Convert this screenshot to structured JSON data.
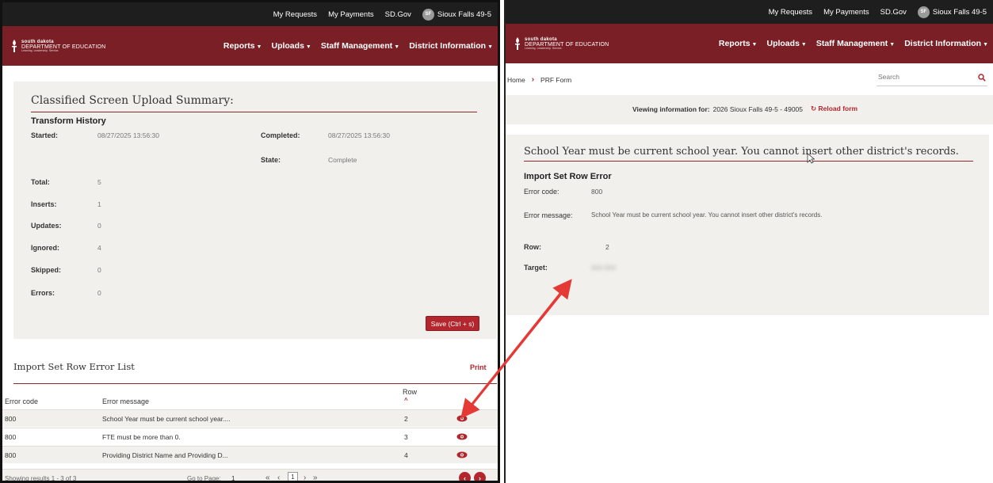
{
  "topbar": {
    "links": [
      "My Requests",
      "My Payments",
      "SD.Gov"
    ],
    "avatar_initials": "SF",
    "user": "Sioux Falls 49-5"
  },
  "brand": {
    "line1": "south dakota",
    "line2": "DEPARTMENT OF EDUCATION",
    "tagline": "Learning. Leadership. Service."
  },
  "nav": {
    "items": [
      "Reports",
      "Uploads",
      "Staff Management",
      "District Information"
    ]
  },
  "summary": {
    "title": "Classified Screen Upload Summary:",
    "section": "Transform History",
    "started_label": "Started:",
    "started_value": "08/27/2025 13:56:30",
    "completed_label": "Completed:",
    "completed_value": "08/27/2025 13:56:30",
    "state_label": "State:",
    "state_value": "Complete",
    "counts": [
      {
        "label": "Total:",
        "value": "5"
      },
      {
        "label": "Inserts:",
        "value": "1"
      },
      {
        "label": "Updates:",
        "value": "0"
      },
      {
        "label": "Ignored:",
        "value": "4"
      },
      {
        "label": "Skipped:",
        "value": "0"
      },
      {
        "label": "Errors:",
        "value": "0"
      }
    ],
    "save_label": "Save (Ctrl + s)"
  },
  "error_list": {
    "title": "Import Set Row Error List",
    "print_label": "Print",
    "headers": {
      "code": "Error code",
      "message": "Error message",
      "row": "Row"
    },
    "rows": [
      {
        "code": "800",
        "message": "School Year must be current school year....",
        "row": "2"
      },
      {
        "code": "800",
        "message": "FTE must be more than 0.",
        "row": "3"
      },
      {
        "code": "800",
        "message": "Providing District Name and Providing D...",
        "row": "4"
      }
    ],
    "showing": "Showing results 1 - 3 of 3",
    "goto_label": "Go to Page:",
    "goto_value": "1",
    "current_page": "1"
  },
  "right": {
    "breadcrumb": {
      "home": "Home",
      "current": "PRF Form"
    },
    "search_placeholder": "Search",
    "viewing_label": "Viewing information for:",
    "viewing_value": "2026 Sioux Falls 49-5 - 49005",
    "reload_label": "Reload form",
    "error_heading": "School Year must be current school year. You cannot insert other district's records.",
    "section": "Import Set Row Error",
    "code_label": "Error code:",
    "code_value": "800",
    "message_label": "Error message:",
    "message_value": "School Year must be current school year. You cannot insert other district's records.",
    "row_label": "Row:",
    "row_value": "2",
    "target_label": "Target:",
    "target_value": "000 000"
  },
  "colors": {
    "brand": "#7a1f26",
    "accent": "#b3262d",
    "panel": "#f2f0ec",
    "arrow": "#e53935"
  }
}
